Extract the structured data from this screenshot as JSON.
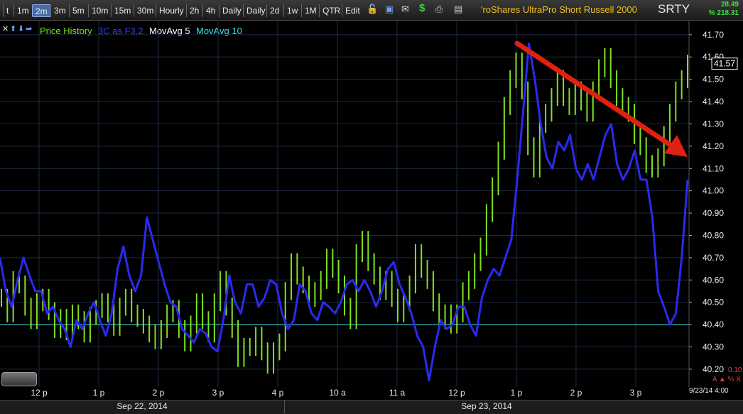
{
  "toolbar": {
    "buttons": [
      "t",
      "1m",
      "2m",
      "3m",
      "5m",
      "10m",
      "15m",
      "30m",
      "Hourly",
      "2h",
      "4h",
      "Daily",
      "Daily",
      "2d",
      "1w",
      "1M",
      "QTR",
      "Edit"
    ],
    "active": "2m",
    "icons": [
      "lock-icon",
      "save-icon",
      "mail-icon",
      "dollar-icon",
      "print-icon",
      "card-icon"
    ],
    "title": "'roShares UltraPro Short Russell 2000",
    "symbol": "SRTY",
    "stat1": "28.49",
    "stat2": "% 218.31"
  },
  "nav": {
    "icons": [
      "cross-icon",
      "arrow-up-icon",
      "arrow-down-icon",
      "arrow-right-icon"
    ]
  },
  "legend": {
    "price_history": "Price History",
    "threec": "3C as F3.2",
    "mavg5": "MovAvg 5",
    "mavg10": "MovAvg 10"
  },
  "colors": {
    "price": "#7fe020",
    "threec": "#2a2af0",
    "mavg5": "#ffffff",
    "mavg10": "#40e0e0",
    "arrow": "#e02010"
  },
  "dates": {
    "day1": "Sep 22, 2014",
    "day2": "Sep 23, 2014"
  },
  "corner": {
    "value": "0.10",
    "labels": "A ▲ % X",
    "timestamp": "9/23/14 4:00"
  },
  "chart_data": {
    "type": "line",
    "ylim": [
      40.12,
      41.76
    ],
    "yticks": [
      "41.70",
      "41.60",
      "41.50",
      "41.40",
      "41.30",
      "41.20",
      "41.10",
      "41.00",
      "40.90",
      "40.80",
      "40.70",
      "40.60",
      "40.50",
      "40.40",
      "40.30",
      "40.20"
    ],
    "last_price": "41.57",
    "xticks": [
      "12 p",
      "1 p",
      "2 p",
      "3 p",
      "4 p",
      "10 a",
      "11 a",
      "12 p",
      "1 p",
      "2 p",
      "3 p"
    ],
    "reference_line": 40.4,
    "price": [
      40.52,
      40.45,
      40.6,
      40.58,
      40.48,
      40.42,
      40.5,
      40.52,
      40.46,
      40.38,
      40.43,
      40.37,
      40.45,
      40.42,
      40.36,
      40.44,
      40.47,
      40.5,
      40.45,
      40.39,
      40.48,
      40.52,
      40.45,
      40.43,
      40.4,
      40.36,
      40.33,
      40.38,
      40.45,
      40.47,
      40.38,
      40.32,
      40.4,
      40.5,
      40.42,
      40.36,
      40.5,
      40.6,
      40.48,
      40.38,
      40.25,
      40.3,
      40.3,
      40.35,
      40.28,
      40.22,
      40.28,
      40.32,
      40.55,
      40.68,
      40.62,
      40.58,
      40.52,
      40.55,
      40.6,
      40.7,
      40.65,
      40.58,
      40.48,
      40.42,
      40.72,
      40.78,
      40.68,
      40.62,
      40.55,
      40.6,
      40.52,
      40.45,
      40.5,
      40.58,
      40.72,
      40.65,
      40.6,
      40.5,
      40.42,
      40.45,
      40.4,
      40.45,
      40.55,
      40.6,
      40.68,
      40.75,
      40.9,
      41.02,
      41.18,
      41.38,
      41.5,
      41.58,
      41.45,
      41.2,
      41.1,
      41.3,
      41.35,
      41.42,
      41.5,
      41.42,
      41.38,
      41.45,
      41.4,
      41.35,
      41.45,
      41.55,
      41.6,
      41.5,
      41.42,
      41.38,
      41.35,
      41.25,
      41.2,
      41.12,
      41.1,
      41.15,
      41.25,
      41.35,
      41.45,
      41.5,
      41.57
    ],
    "oscillator_3c": [
      40.7,
      40.55,
      40.48,
      40.6,
      40.7,
      40.62,
      40.55,
      40.55,
      40.45,
      40.48,
      40.42,
      40.38,
      40.3,
      40.42,
      40.38,
      40.45,
      40.5,
      40.42,
      40.35,
      40.45,
      40.65,
      40.75,
      40.62,
      40.55,
      40.62,
      40.88,
      40.78,
      40.68,
      40.58,
      40.5,
      40.48,
      40.38,
      40.35,
      40.32,
      40.38,
      40.36,
      40.3,
      40.28,
      40.42,
      40.62,
      40.5,
      40.45,
      40.58,
      40.58,
      40.48,
      40.52,
      40.6,
      40.58,
      40.45,
      40.38,
      40.42,
      40.58,
      40.55,
      40.45,
      40.42,
      40.5,
      40.48,
      40.45,
      40.5,
      40.58,
      40.6,
      40.55,
      40.6,
      40.55,
      40.48,
      40.55,
      40.65,
      40.68,
      40.58,
      40.52,
      40.45,
      40.35,
      40.3,
      40.15,
      40.3,
      40.42,
      40.38,
      40.4,
      40.48,
      40.48,
      40.4,
      40.35,
      40.52,
      40.6,
      40.65,
      40.62,
      40.7,
      40.78,
      41.05,
      41.35,
      41.66,
      41.5,
      41.3,
      41.15,
      41.1,
      41.22,
      41.18,
      41.25,
      41.1,
      41.05,
      41.12,
      41.05,
      41.15,
      41.25,
      41.3,
      41.12,
      41.05,
      41.1,
      41.18,
      41.05,
      41.05,
      40.88,
      40.55,
      40.48,
      40.4,
      40.45,
      40.7,
      41.05
    ]
  }
}
